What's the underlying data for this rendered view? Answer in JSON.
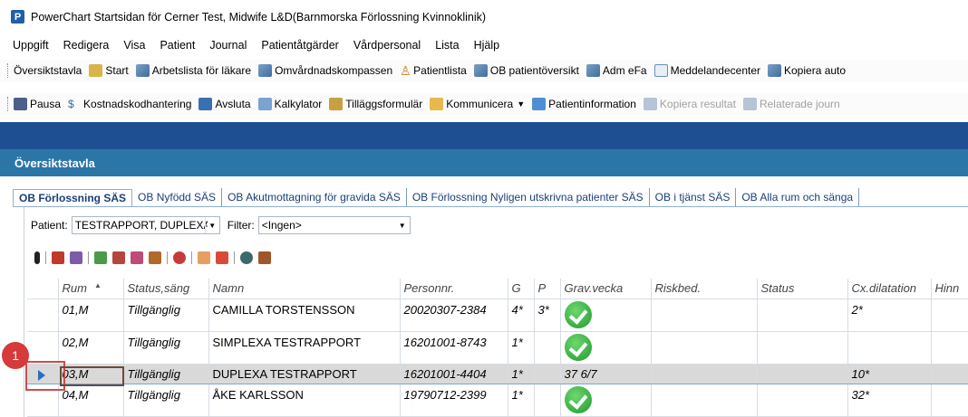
{
  "window": {
    "title": "PowerChart Startsidan för Cerner Test, Midwife L&D(Barnmorska Förlossning Kvinnoklinik)",
    "app_icon_letter": "P"
  },
  "menu": [
    "Uppgift",
    "Redigera",
    "Visa",
    "Patient",
    "Journal",
    "Patientåtgärder",
    "Vårdpersonal",
    "Lista",
    "Hjälp"
  ],
  "toolbar1": [
    {
      "label": "Översiktstavla",
      "icon": "none"
    },
    {
      "label": "Start",
      "icon": "house-icon"
    },
    {
      "label": "Arbetslista för läkare",
      "icon": "grid-icon"
    },
    {
      "label": "Omvårdnadskompassen",
      "icon": "grid-icon"
    },
    {
      "label": "Patientlista",
      "icon": "person-icon"
    },
    {
      "label": "OB patientöversikt",
      "icon": "grid-icon"
    },
    {
      "label": "Adm eFa",
      "icon": "grid-icon"
    },
    {
      "label": "Meddelandecenter",
      "icon": "message-icon"
    },
    {
      "label": "Kopiera auto",
      "icon": "grid-icon"
    }
  ],
  "toolbar2": [
    {
      "label": "Pausa",
      "icon": "pause-icon"
    },
    {
      "label": "Kostnadskodhantering",
      "icon": "money-icon"
    },
    {
      "label": "Avsluta",
      "icon": "exit-icon"
    },
    {
      "label": "Kalkylator",
      "icon": "calculator-icon"
    },
    {
      "label": "Tilläggsformulär",
      "icon": "form-icon"
    },
    {
      "label": "Kommunicera",
      "icon": "communicate-icon"
    },
    {
      "label": "Patientinformation",
      "icon": "info-icon"
    },
    {
      "label": "Kopiera resultat",
      "icon": "copy-icon"
    },
    {
      "label": "Relaterade journ",
      "icon": "related-icon"
    }
  ],
  "section_title": "Översiktstavla",
  "tabs": [
    "OB Förlossning SÄS",
    "OB Nyfödd SÄS",
    "OB Akutmottagning för gravida SÄS",
    "OB Förlossning Nyligen utskrivna patienter SÄS",
    "OB i tjänst SÄS",
    "OB Alla rum och sänga"
  ],
  "filters": {
    "patient_label": "Patient:",
    "patient_value": "TESTRAPPORT, DUPLEXA",
    "filter_label": "Filter:",
    "filter_value": "<Ingen>"
  },
  "table": {
    "columns": [
      "Rum",
      "Status,säng",
      "Namn",
      "Personnr.",
      "G",
      "P",
      "Grav.vecka",
      "Riskbed.",
      "Status",
      "Cx.dilatation",
      "Hinn"
    ],
    "rows": [
      {
        "rum": "01,M",
        "status": "Tillgänglig",
        "namn": "CAMILLA TORSTENSSON",
        "personnr": "20020307-2384",
        "g": "4*",
        "p": "3*",
        "grav": "",
        "check": true,
        "cx": "2*"
      },
      {
        "rum": "02,M",
        "status": "Tillgänglig",
        "namn": "SIMPLEXA TESTRAPPORT",
        "personnr": "16201001-8743",
        "g": "1*",
        "p": "",
        "grav": "",
        "check": true,
        "cx": ""
      },
      {
        "rum": "03,M",
        "status": "Tillgänglig",
        "namn": "DUPLEXA TESTRAPPORT",
        "personnr": "16201001-4404",
        "g": "1*",
        "p": "",
        "grav": "37 6/7",
        "check": false,
        "cx": "10*"
      },
      {
        "rum": "04,M",
        "status": "Tillgänglig",
        "namn": "ÅKE KARLSSON",
        "personnr": "19790712-2399",
        "g": "1*",
        "p": "",
        "grav": "",
        "check": true,
        "cx": "32*"
      }
    ],
    "selected_row_index": 2
  },
  "callout": {
    "number": "1"
  },
  "colors": {
    "band": "#1e4f93",
    "section_header": "#2c76a7",
    "callout": "#d63a3a",
    "check": "#1e9a2d"
  }
}
